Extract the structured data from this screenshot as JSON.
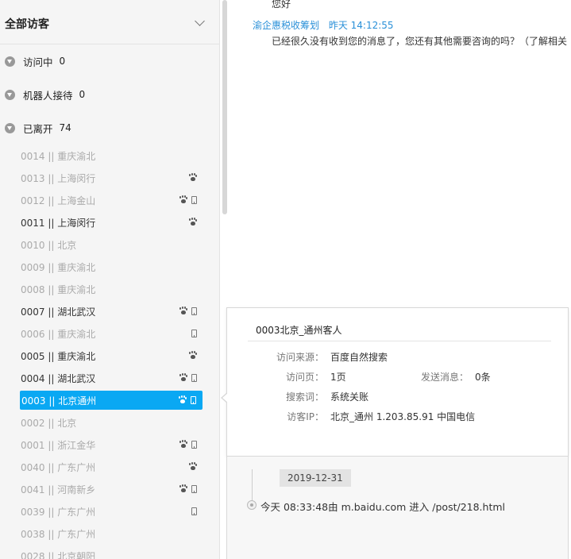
{
  "sidebar": {
    "title": "全部访客",
    "groups": [
      {
        "label": "访问中",
        "count": "0"
      },
      {
        "label": "机器人接待",
        "count": "0"
      },
      {
        "label": "已离开",
        "count": "74"
      }
    ],
    "visitors": [
      {
        "label": "0014 || 重庆渝北",
        "online": false,
        "paw": false,
        "mobile": false
      },
      {
        "label": "0013 || 上海闵行",
        "online": false,
        "paw": true,
        "mobile": false
      },
      {
        "label": "0012 || 上海金山",
        "online": false,
        "paw": true,
        "mobile": true
      },
      {
        "label": "0011 || 上海闵行",
        "online": true,
        "paw": true,
        "mobile": false
      },
      {
        "label": "0010 || 北京",
        "online": false,
        "paw": false,
        "mobile": false
      },
      {
        "label": "0009 || 重庆渝北",
        "online": false,
        "paw": false,
        "mobile": false
      },
      {
        "label": "0008 || 重庆渝北",
        "online": false,
        "paw": false,
        "mobile": false
      },
      {
        "label": "0007 || 湖北武汉",
        "online": true,
        "paw": true,
        "mobile": true
      },
      {
        "label": "0006 || 重庆渝北",
        "online": false,
        "paw": false,
        "mobile": true
      },
      {
        "label": "0005 || 重庆渝北",
        "online": true,
        "paw": true,
        "mobile": false
      },
      {
        "label": "0004 || 湖北武汉",
        "online": true,
        "paw": true,
        "mobile": true
      },
      {
        "label": "0003 || 北京通州",
        "online": true,
        "paw": true,
        "mobile": true,
        "active": true
      },
      {
        "label": "0002 || 北京",
        "online": false,
        "paw": false,
        "mobile": false
      },
      {
        "label": "0001 || 浙江金华",
        "online": false,
        "paw": true,
        "mobile": true
      },
      {
        "label": "0040 || 广东广州",
        "online": false,
        "paw": true,
        "mobile": false
      },
      {
        "label": "0041 || 河南新乡",
        "online": false,
        "paw": true,
        "mobile": true
      },
      {
        "label": "0039 || 广东广州",
        "online": false,
        "paw": false,
        "mobile": true
      },
      {
        "label": "0038 || 广东广州",
        "online": false,
        "paw": false,
        "mobile": false
      },
      {
        "label": "0028 || 北京朝阳",
        "online": false,
        "paw": false,
        "mobile": false
      }
    ]
  },
  "chat": {
    "prev_message": "您好",
    "sender": "渝企惠税收筹划",
    "time": "昨天 14:12:55",
    "message": "已经很久没有收到您的消息了，您还有其他需要咨询的吗？（了解相关"
  },
  "popup": {
    "title": "0003北京_通州客人",
    "source_label": "访问来源：",
    "source_value": "百度自然搜索",
    "pages_label": "访问页：",
    "pages_value": "1页",
    "messages_label": "发送消息：",
    "messages_value": "0条",
    "keyword_label": "搜索词：",
    "keyword_value": "系统关账",
    "ip_label": "访客IP：",
    "ip_value": "北京_通州 1.203.85.91 中国电信"
  },
  "timeline": {
    "date": "2019-12-31",
    "event": "今天 08:33:48由 m.baidu.com 进入 /post/218.html"
  },
  "colors": {
    "accent": "#0aa8f3",
    "link": "#2a90d8"
  }
}
